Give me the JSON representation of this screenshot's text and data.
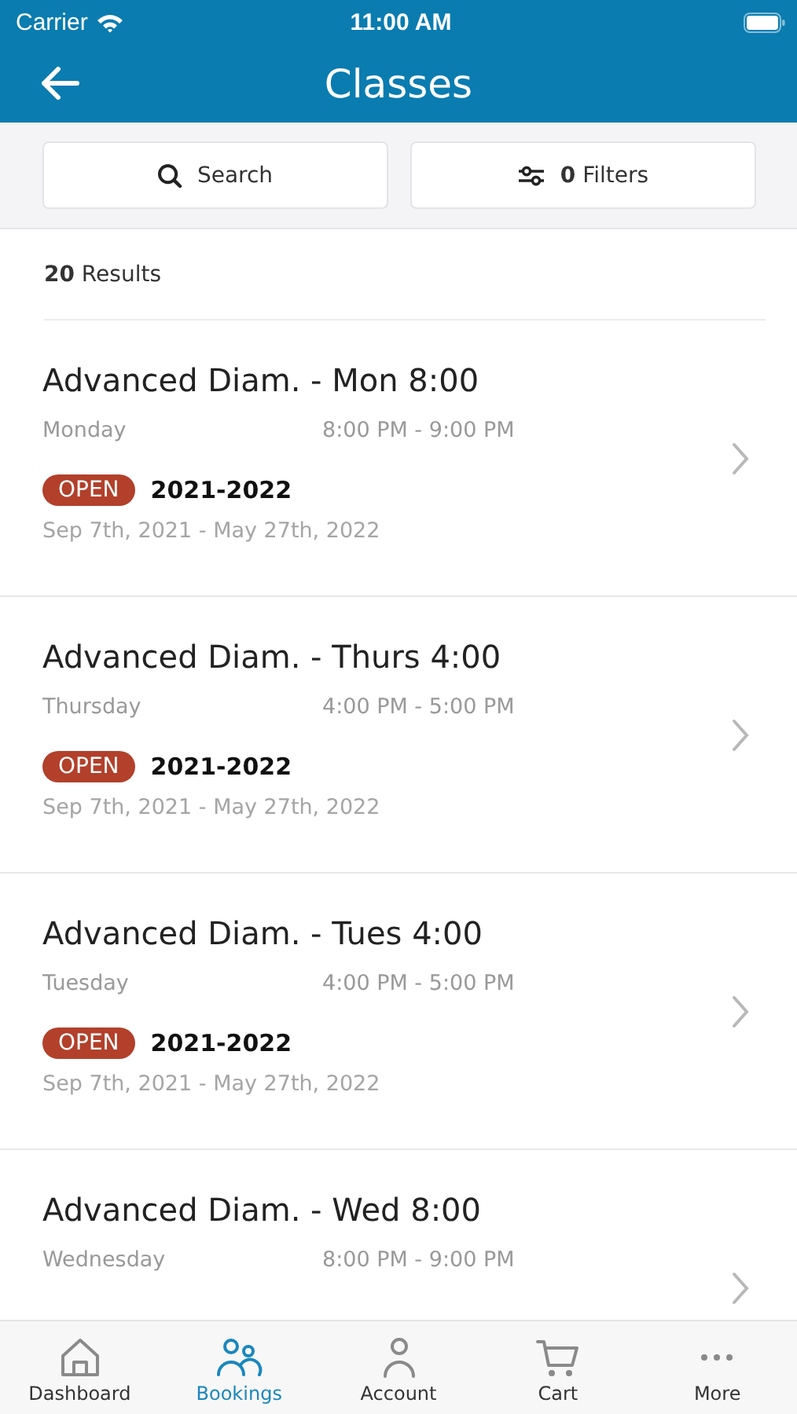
{
  "status_bar": {
    "carrier": "Carrier",
    "time": "11:00 AM"
  },
  "nav": {
    "title": "Classes"
  },
  "search": {
    "label": "Search"
  },
  "filters": {
    "count": "0",
    "label": "Filters"
  },
  "results": {
    "count": "20",
    "label": "Results"
  },
  "classes": [
    {
      "title": "Advanced Diam. - Mon 8:00",
      "day": "Monday",
      "time": "8:00 PM - 9:00 PM",
      "status": "OPEN",
      "season": "2021-2022",
      "dates": "Sep 7th, 2021 - May 27th, 2022"
    },
    {
      "title": "Advanced Diam. - Thurs 4:00",
      "day": "Thursday",
      "time": "4:00 PM - 5:00 PM",
      "status": "OPEN",
      "season": "2021-2022",
      "dates": "Sep 7th, 2021 - May 27th, 2022"
    },
    {
      "title": "Advanced Diam. - Tues 4:00",
      "day": "Tuesday",
      "time": "4:00 PM - 5:00 PM",
      "status": "OPEN",
      "season": "2021-2022",
      "dates": "Sep 7th, 2021 - May 27th, 2022"
    },
    {
      "title": "Advanced Diam. - Wed 8:00",
      "day": "Wednesday",
      "time": "8:00 PM - 9:00 PM"
    }
  ],
  "tabs": [
    {
      "kind": "home",
      "label": "Dashboard",
      "selected": false
    },
    {
      "kind": "people",
      "label": "Bookings",
      "selected": true
    },
    {
      "kind": "person",
      "label": "Account",
      "selected": false
    },
    {
      "kind": "cart",
      "label": "Cart",
      "selected": false
    },
    {
      "kind": "more",
      "label": "More",
      "selected": false
    }
  ]
}
